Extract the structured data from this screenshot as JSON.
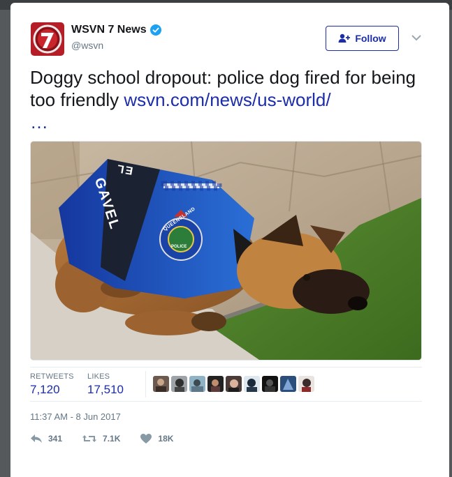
{
  "account": {
    "name": "WSVN 7 News",
    "handle": "@wsvn",
    "avatar_digit": "7"
  },
  "follow": {
    "label": "Follow"
  },
  "tweet": {
    "text": "Doggy school dropout: police dog fired for being too friendly ",
    "link": "wsvn.com/news/us-world/",
    "ellipsis": "…"
  },
  "photo": {
    "vest_name": "GAVEL",
    "vest_name_top": "EL",
    "badge_text": "QUEENSLAND",
    "badge_sub": "POLICE"
  },
  "stats": {
    "retweets_label": "RETWEETS",
    "retweets_value": "7,120",
    "likes_label": "LIKES",
    "likes_value": "17,510"
  },
  "timestamp": "11:37 AM - 8 Jun 2017",
  "actions": {
    "reply_count": "341",
    "retweet_count": "7.1K",
    "like_count": "18K"
  },
  "colors": {
    "accent": "#1b2da8",
    "muted": "#657786"
  }
}
